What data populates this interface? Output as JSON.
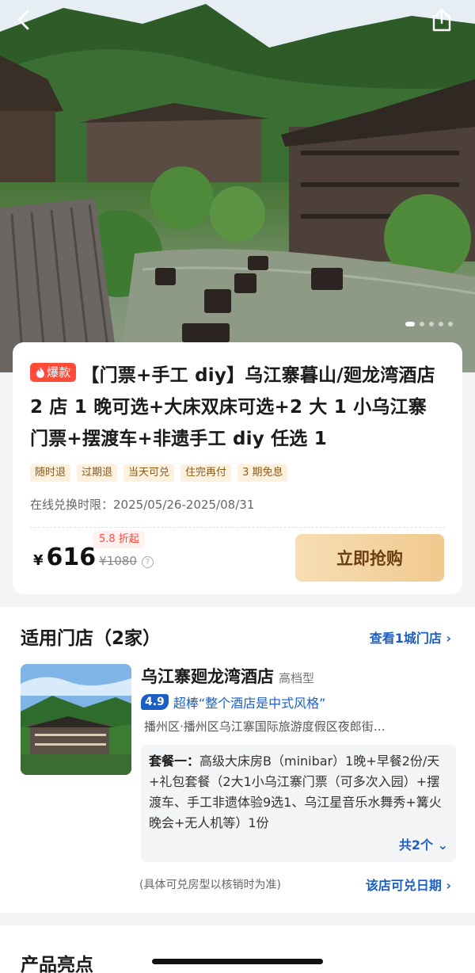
{
  "header": {
    "back_icon": "chevron-left-icon",
    "share_icon": "share-icon",
    "carousel_pages": 5,
    "carousel_active": 1
  },
  "product": {
    "hot_badge": "爆款",
    "title": "【门票+手工 diy】乌江寨暮山/廻龙湾酒店 2 店 1 晚可选+大床双床可选+2 大 1 小乌江寨门票+摆渡车+非遗手工 diy 任选 1",
    "tags": [
      "随时退",
      "过期退",
      "当天可兑",
      "住完再付",
      "3 期免息"
    ],
    "exchange_label": "在线兑换时限：",
    "exchange_period": "2025/05/26-2025/08/31",
    "discount": "5.8 折起",
    "currency": "¥",
    "price": "616",
    "original_price": "¥1080",
    "buy_label": "立即抢购"
  },
  "stores": {
    "title": "适用门店（2家）",
    "view_link": "查看1城门店 ›",
    "hotel": {
      "name": "乌江寨廻龙湾酒店",
      "level": "高档型",
      "score": "4.9",
      "review": "超棒“整个酒店是中式风格”",
      "address": "播州区·播州区乌江寨国际旅游度假区夜郎街…",
      "package_label": "套餐一：",
      "package_text": "高级大床房B（minibar）1晚+早餐2份/天+礼包套餐（2大1小乌江寨门票（可多次入园）+摆渡车、手工非遗体验9选1、乌江星音乐水舞秀+篝火晚会+无人机等）1份",
      "more": "共2个 ⌄"
    },
    "note": "(具体可兑房型以核销时为准)",
    "dates_link": "该店可兑日期 ›"
  },
  "highlights": {
    "title": "产品亮点"
  },
  "colors": {
    "accent_blue": "#1b5fc4",
    "hot_red": "#ff4b3a",
    "buy_gold": "#f0c98e"
  }
}
